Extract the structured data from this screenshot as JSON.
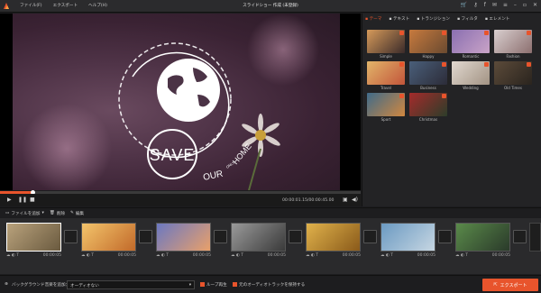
{
  "window": {
    "title": "スライドショー 作成 (未登録)",
    "menu": [
      "ファイル(F)",
      "エクスポート",
      "ヘルプ(H)"
    ]
  },
  "preview": {
    "overlay_text": {
      "save": "SAVE",
      "our": "OUR",
      "only": "ONLY",
      "home": "HOME"
    },
    "timecode": "00:00:01.15/00:00:45.00",
    "progress": 0.09
  },
  "right_panel": {
    "tabs": [
      {
        "label": "テーマ",
        "icon": "theme-icon",
        "active": true
      },
      {
        "label": "テキスト",
        "icon": "text-icon"
      },
      {
        "label": "トランジション",
        "icon": "transition-icon"
      },
      {
        "label": "フィルタ",
        "icon": "filter-icon"
      },
      {
        "label": "エレメント",
        "icon": "element-icon"
      }
    ],
    "themes": [
      {
        "label": "Simple",
        "c1": "#d69a5a",
        "c2": "#3b2b2a"
      },
      {
        "label": "Happy",
        "c1": "#c77a3e",
        "c2": "#6a4a30"
      },
      {
        "label": "Romantic",
        "c1": "#8a6fb1",
        "c2": "#c9a3c7"
      },
      {
        "label": "Fashion",
        "c1": "#d9cfcf",
        "c2": "#8c6f6f"
      },
      {
        "label": "Travel",
        "c1": "#e2b56a",
        "c2": "#c2553a"
      },
      {
        "label": "Business",
        "c1": "#4a5f7a",
        "c2": "#2c2c38"
      },
      {
        "label": "Wedding",
        "c1": "#e1d8d0",
        "c2": "#a29383"
      },
      {
        "label": "Old Times",
        "c1": "#5c4b3a",
        "c2": "#2a241e"
      },
      {
        "label": "Sport",
        "c1": "#3f6b8a",
        "c2": "#d0873f"
      },
      {
        "label": "Christmas",
        "c1": "#a52b2b",
        "c2": "#2d3d2a"
      }
    ]
  },
  "toolbar": {
    "add_files": "ファイルを追加",
    "delete": "削除",
    "edit": "編集"
  },
  "timeline": {
    "clips": [
      {
        "time": "00:00:05",
        "c1": "#b9a27c",
        "c2": "#6a5a3f"
      },
      {
        "time": "00:00:05",
        "c1": "#f3c46b",
        "c2": "#c26a2a"
      },
      {
        "time": "00:00:05",
        "c1": "#6b78c2",
        "c2": "#e9a06a"
      },
      {
        "time": "00:00:05",
        "c1": "#9a9a9a",
        "c2": "#3a3a3a"
      },
      {
        "time": "00:00:05",
        "c1": "#e0b24b",
        "c2": "#8a5a1a"
      },
      {
        "time": "00:00:05",
        "c1": "#6b9ac2",
        "c2": "#c6d6e2"
      },
      {
        "time": "00:00:05",
        "c1": "#5a8a4a",
        "c2": "#2a3a2a"
      }
    ]
  },
  "bottom": {
    "bgm_label": "バックグラウンド音楽を追加：",
    "audio_value": "オーディオない",
    "loop": "ループ再生",
    "keep_original": "元のオーディオトラックを保持する",
    "export": "エクスポート"
  },
  "colors": {
    "accent": "#e8542c"
  }
}
